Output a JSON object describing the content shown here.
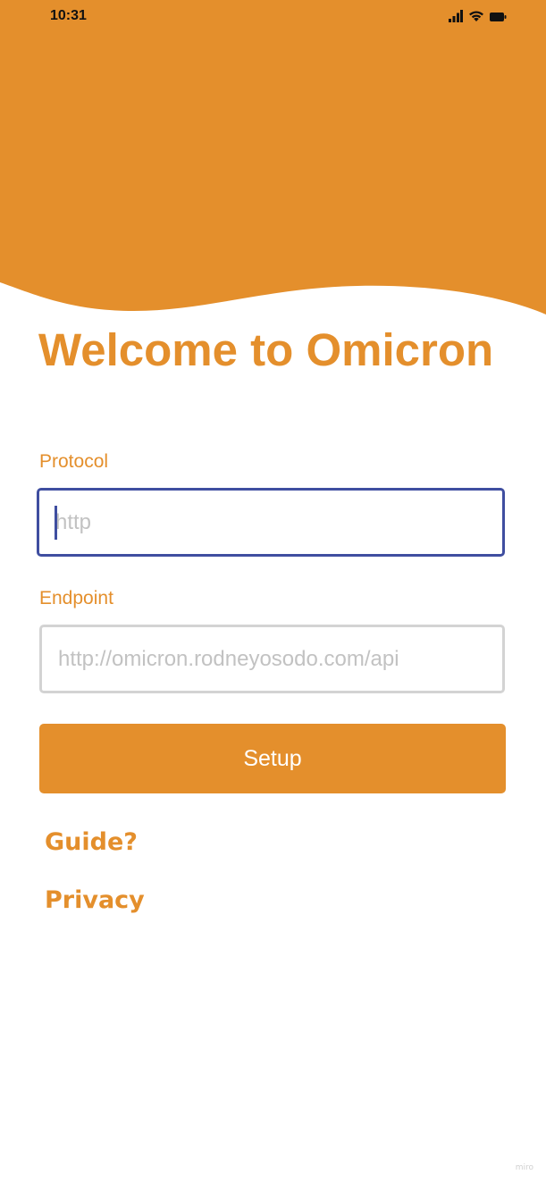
{
  "colors": {
    "brand": "#e48f2c",
    "focus_border": "#3f4ea0",
    "input_border": "#d3d3d3",
    "placeholder": "#c2c2c2"
  },
  "status_bar": {
    "time": "10:31",
    "icons": [
      "cellular-signal-icon",
      "wifi-icon",
      "battery-icon"
    ]
  },
  "welcome": {
    "title": "Welcome to Omicron"
  },
  "form": {
    "protocol": {
      "label": "Protocol",
      "value": "",
      "placeholder": "http"
    },
    "endpoint": {
      "label": "Endpoint",
      "value": "",
      "placeholder": "http://omicron.rodneyosodo.com/api"
    },
    "setup_label": "Setup"
  },
  "links": {
    "guide": "Guide?",
    "privacy": "Privacy"
  },
  "watermark": "miro"
}
